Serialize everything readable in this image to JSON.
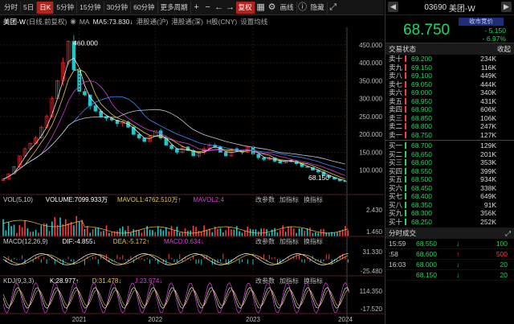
{
  "toolbar": {
    "items": [
      "分时",
      "5日",
      "日K",
      "5分钟",
      "15分钟",
      "30分钟",
      "60分钟",
      "更多周期"
    ],
    "mode_dropdown": "复权",
    "chart_label": "画线",
    "hide_label": "隐藏"
  },
  "info": {
    "name": "美团-W",
    "adj": "(日线,前复权)",
    "ma": "MA",
    "ma5": "MA5:73.830↓",
    "hk_sh": "港股通(沪)",
    "hk_sz": "港股通(深)",
    "hcny": "H股(CNY)",
    "settings": "设置均线"
  },
  "colors": {
    "up": "#ff3b3b",
    "down": "#1ec8c8",
    "price_green": "#1ed760",
    "ma5": "#e8e8e8",
    "ma10": "#e8c840",
    "ma20": "#d040d0",
    "ma60": "#3a8fff",
    "ma120": "#c8c8c8",
    "ma250": "#c8b040"
  },
  "chart_data": {
    "type": "candlestick",
    "ylim": [
      50,
      490
    ],
    "yticks": [
      "450.000",
      "400.000",
      "350.000",
      "300.000",
      "250.000",
      "200.000",
      "150.000",
      "100.000"
    ],
    "x": [
      "2021",
      "2022",
      "2023",
      "2024"
    ],
    "close": [
      75,
      90,
      110,
      140,
      160,
      175,
      190,
      220,
      250,
      300,
      350,
      400,
      460,
      380,
      320,
      310,
      280,
      265,
      250,
      245,
      240,
      230,
      235,
      220,
      200,
      190,
      180,
      195,
      210,
      190,
      170,
      160,
      150,
      165,
      155,
      140,
      150,
      160,
      170,
      165,
      150,
      140,
      160,
      155,
      150,
      165,
      145,
      135,
      130,
      135,
      125,
      120,
      128,
      125,
      118,
      110,
      108,
      100,
      95,
      85,
      80,
      75,
      70,
      68.15
    ],
    "max_label": "460.000",
    "min_label": "68.150",
    "panels": {
      "vol": {
        "name": "VOL(5,10)",
        "volume": "VOLUME:7099.933万",
        "mavol1": "MAVOL1:4762.510万↑",
        "mavol2": "MAVOL2:4",
        "ticks": [
          "2.430",
          "1.460"
        ]
      },
      "macd": {
        "name": "MACD(12,26,9)",
        "dif": "DIF:-4.855↓",
        "dea": "DEA:-5.172↑",
        "macd": "MACD:0.634↓",
        "ticks": [
          "31.330",
          "-25.480"
        ]
      },
      "kdj": {
        "name": "KDJ(9,3,3)",
        "k": "K:28.977↑",
        "d": "D:31.478↓",
        "j": "J:23.974↓",
        "ticks": [
          "114.350",
          "-17.520"
        ]
      }
    },
    "panel_buttons": [
      "改参数",
      "加指标",
      "换指标"
    ]
  },
  "quote": {
    "code": "03690",
    "name": "美团-W",
    "last": "68.750",
    "tag": "收市竞价",
    "change": "- 5.150",
    "pct": "- 6.97%"
  },
  "orderbook": {
    "title": "交易状态",
    "collapse": "收起",
    "asks": [
      [
        "卖十",
        "69.200",
        "234K"
      ],
      [
        "卖九",
        "69.150",
        "116K"
      ],
      [
        "卖八",
        "69.100",
        "449K"
      ],
      [
        "卖七",
        "69.050",
        "444K"
      ],
      [
        "卖六",
        "69.000",
        "340K"
      ],
      [
        "卖五",
        "68.950",
        "431K"
      ],
      [
        "卖四",
        "68.900",
        "606K"
      ],
      [
        "卖三",
        "68.850",
        "106K"
      ],
      [
        "卖二",
        "68.800",
        "247K"
      ],
      [
        "卖一",
        "68.750",
        "127K"
      ]
    ],
    "bids": [
      [
        "买一",
        "68.700",
        "129K"
      ],
      [
        "买二",
        "68.650",
        "201K"
      ],
      [
        "买三",
        "68.600",
        "353K"
      ],
      [
        "买四",
        "68.550",
        "399K"
      ],
      [
        "买五",
        "68.500",
        "934K"
      ],
      [
        "买六",
        "68.450",
        "338K"
      ],
      [
        "买七",
        "68.400",
        "649K"
      ],
      [
        "买八",
        "68.350",
        "91K"
      ],
      [
        "买九",
        "68.300",
        "356K"
      ],
      [
        "买十",
        "68.250",
        "252K"
      ]
    ]
  },
  "trades": {
    "title": "分时成交",
    "rows": [
      [
        "15:59",
        "68.550",
        "↓",
        "100"
      ],
      [
        ":58",
        "68.600",
        "↑",
        "500"
      ],
      [
        "16:03",
        "68.000",
        "↓",
        "20"
      ],
      [
        "",
        "68.150",
        "↓",
        "20"
      ]
    ]
  }
}
